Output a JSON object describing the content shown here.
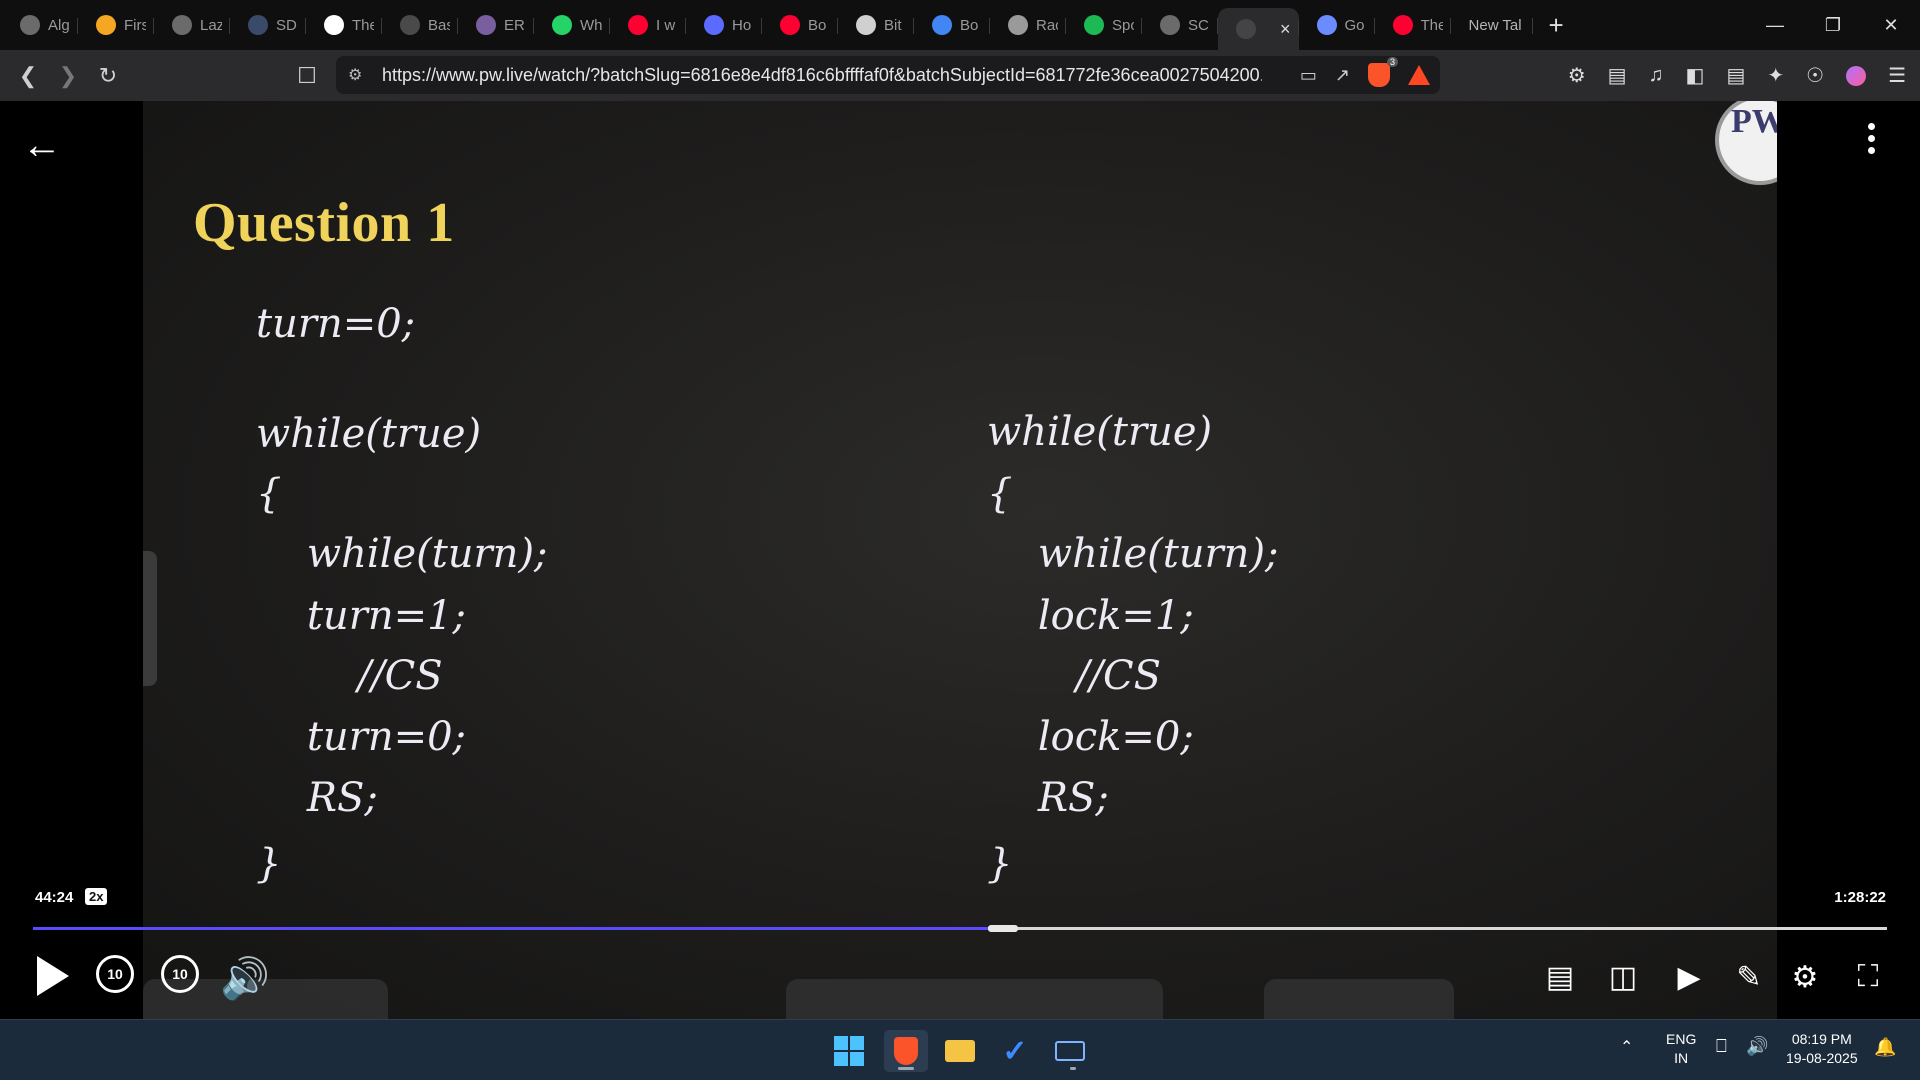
{
  "browser": {
    "tabs": [
      {
        "title": "Alg",
        "icon": "chatgpt-icon",
        "color": "#6b6b6b"
      },
      {
        "title": "Firs",
        "icon": "bolt-icon",
        "color": "#f5a623"
      },
      {
        "title": "Laz",
        "icon": "globe-icon",
        "color": "#6b6b6b"
      },
      {
        "title": "SDI",
        "icon": "sdi-icon",
        "color": "#3a4b6a"
      },
      {
        "title": "The",
        "icon": "w3-icon",
        "color": "#ffffff"
      },
      {
        "title": "Bas",
        "icon": "bas-icon",
        "color": "#4a4a4a"
      },
      {
        "title": "ERI",
        "icon": "erp-icon",
        "color": "#7a5fa0"
      },
      {
        "title": "Wh",
        "icon": "whatsapp-icon",
        "color": "#25d366"
      },
      {
        "title": "I w",
        "icon": "youtube-icon",
        "color": "#ff0033"
      },
      {
        "title": "Ho",
        "icon": "feather-icon",
        "color": "#5b6bff"
      },
      {
        "title": "Bo",
        "icon": "youtube-icon",
        "color": "#ff0033"
      },
      {
        "title": "Bit",
        "icon": "bitly-icon",
        "color": "#d0d0d0"
      },
      {
        "title": "Bo",
        "icon": "google-icon",
        "color": "#4285f4"
      },
      {
        "title": "Rac",
        "icon": "openai-icon",
        "color": "#9a9a9a"
      },
      {
        "title": "Spo",
        "icon": "spotify-icon",
        "color": "#1db954"
      },
      {
        "title": "SCI",
        "icon": "globe-icon",
        "color": "#6b6b6b"
      }
    ],
    "active_tab_close": "×",
    "tabs_after": [
      {
        "title": "Go",
        "icon": "gemini-icon",
        "color": "#6b8cff"
      },
      {
        "title": "The",
        "icon": "youtube-icon",
        "color": "#ff0033"
      }
    ],
    "new_tab_title": "New Tal",
    "url": "https://www.pw.live/watch/?batchSlug=6816e8e4df816c6bffffaf0f&batchSubjectId=681772fe36cea0027504200...",
    "shield_count": "3"
  },
  "video": {
    "question_title": "Question 1",
    "left_code": [
      "turn=0;",
      "",
      "while(true)",
      "{",
      "    while(turn);",
      "    turn=1;",
      "        //CS",
      "    turn=0;",
      "    RS;",
      "}"
    ],
    "right_code": [
      "while(true)",
      "{",
      "    while(turn);",
      "    lock=1;",
      "       //CS",
      "    lock=0;",
      "    RS;",
      "}"
    ],
    "logo_text": "PW",
    "current_time": "44:24",
    "speed": "2x",
    "total_time": "1:28:22",
    "progress": 0.515,
    "skip_back_label": "10",
    "skip_forward_label": "10"
  },
  "taskbar": {
    "lang_line1": "ENG",
    "lang_line2": "IN",
    "time": "08:19 PM",
    "date": "19-08-2025"
  }
}
